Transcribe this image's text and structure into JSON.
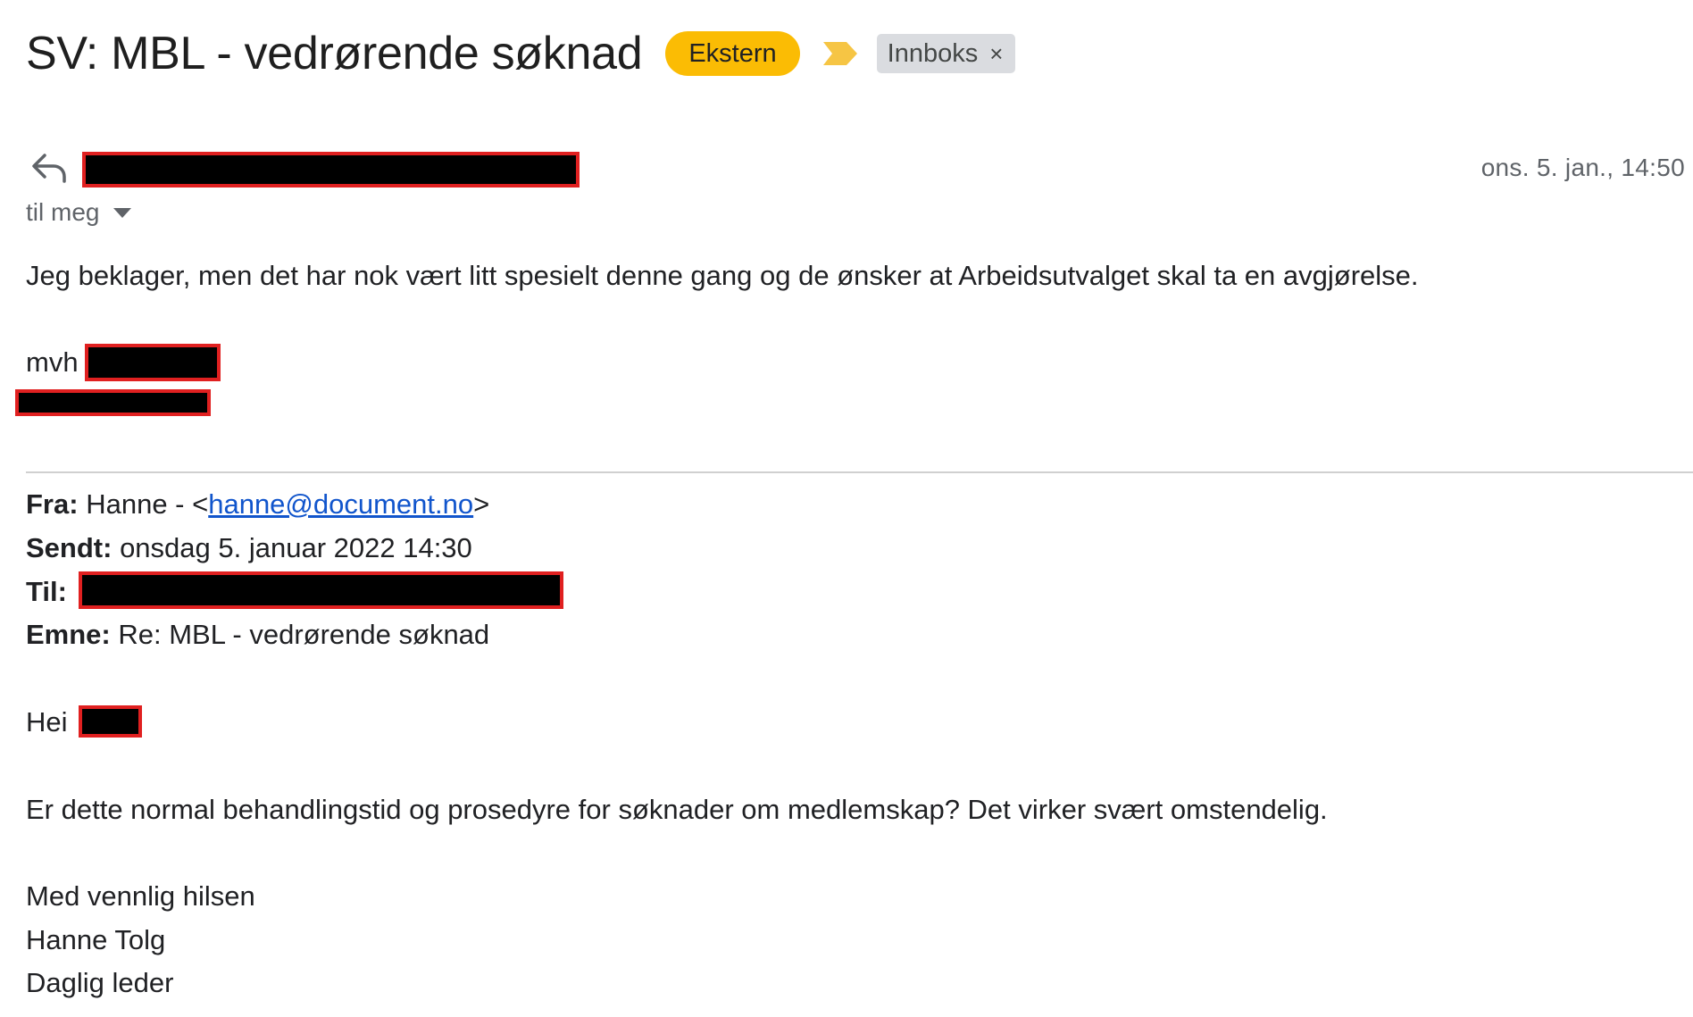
{
  "email": {
    "subject": "SV: MBL - vedrørende søknad",
    "labels": {
      "external": "Ekstern",
      "inbox": "Innboks",
      "inbox_remove": "×"
    },
    "colors": {
      "external_label": "#fbbc04",
      "importance_marker": "#f6c544",
      "inbox_label": "#dadce0",
      "redaction_border": "#e02020"
    },
    "timestamp": "ons. 5. jan., 14:50",
    "recipient_summary": "til meg",
    "body": "Jeg beklager, men det har nok vært litt spesielt denne gang og de ønsker at Arbeidsutvalget skal ta en avgjørelse.",
    "signoff": "mvh",
    "quoted": {
      "from_label": "Fra:",
      "from_name": "Hanne - <",
      "from_email": "hanne@document.no",
      "from_close": ">",
      "sent_label": "Sendt:",
      "sent_value": "onsdag 5. januar 2022 14:30",
      "to_label": "Til:",
      "subject_label": "Emne:",
      "subject_value": "Re: MBL - vedrørende søknad",
      "greeting": "Hei",
      "body": "Er dette normal behandlingstid og prosedyre for søknader om medlemskap? Det virker svært omstendelig.",
      "closing_1": "Med vennlig hilsen",
      "closing_2": "Hanne Tolg",
      "closing_3": "Daglig leder"
    }
  }
}
